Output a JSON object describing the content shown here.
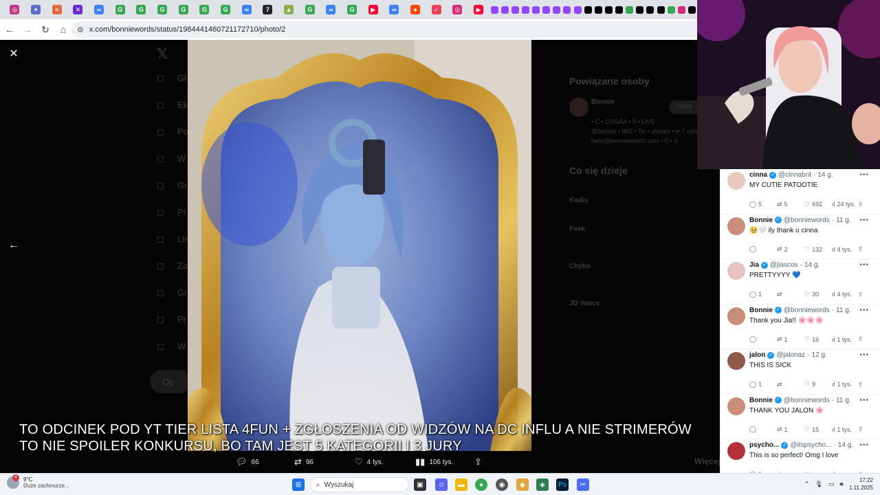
{
  "browser": {
    "url": "x.com/bonniewords/status/1984441460721172710/photo/2",
    "tabs": [
      {
        "icon": "instagram-favicon",
        "color": "#c13584",
        "glyph": "◎"
      },
      {
        "icon": "sparkle-favicon",
        "color": "#5b6cd1",
        "glyph": "✦"
      },
      {
        "icon": "stack-favicon",
        "color": "#e86a3a",
        "glyph": "≡"
      },
      {
        "icon": "x-close-favicon",
        "color": "#6a2bd3",
        "glyph": "✕"
      },
      {
        "icon": "copilot-favicon",
        "color": "#3b82f6",
        "glyph": "∞"
      },
      {
        "icon": "google-favicon",
        "color": "#34a853",
        "glyph": "G"
      },
      {
        "icon": "google-favicon",
        "color": "#34a853",
        "glyph": "G"
      },
      {
        "icon": "google-favicon",
        "color": "#34a853",
        "glyph": "G"
      },
      {
        "icon": "google-favicon",
        "color": "#34a853",
        "glyph": "G"
      },
      {
        "icon": "google-favicon",
        "color": "#34a853",
        "glyph": "G"
      },
      {
        "icon": "google-favicon",
        "color": "#34a853",
        "glyph": "G"
      },
      {
        "icon": "copilot-favicon",
        "color": "#3b82f6",
        "glyph": "∞"
      },
      {
        "icon": "seven-favicon",
        "color": "#222222",
        "glyph": "7"
      },
      {
        "icon": "drive-favicon",
        "color": "#8ab04a",
        "glyph": "▲"
      },
      {
        "icon": "google-favicon",
        "color": "#34a853",
        "glyph": "G"
      },
      {
        "icon": "copilot-favicon",
        "color": "#3b82f6",
        "glyph": "∞"
      },
      {
        "icon": "google-favicon",
        "color": "#34a853",
        "glyph": "G"
      },
      {
        "icon": "youtube-favicon",
        "color": "#ff0033",
        "glyph": "▶"
      },
      {
        "icon": "copilot-favicon",
        "color": "#3b82f6",
        "glyph": "∞"
      },
      {
        "icon": "reddit-favicon",
        "color": "#ff4500",
        "glyph": "●"
      },
      {
        "icon": "pocket-favicon",
        "color": "#ef3f56",
        "glyph": "✓"
      },
      {
        "icon": "instagram-favicon",
        "color": "#d62976",
        "glyph": "◎"
      },
      {
        "icon": "youtube-favicon",
        "color": "#ff0033",
        "glyph": "▶"
      }
    ],
    "small_tabs": [
      {
        "icon": "twitch-favicon",
        "color": "#9146ff"
      },
      {
        "icon": "twitch-favicon",
        "color": "#9146ff"
      },
      {
        "icon": "twitch-favicon",
        "color": "#9146ff"
      },
      {
        "icon": "twitch-favicon",
        "color": "#9146ff"
      },
      {
        "icon": "twitch-favicon",
        "color": "#9146ff"
      },
      {
        "icon": "twitch-favicon",
        "color": "#9146ff"
      },
      {
        "icon": "twitch-favicon",
        "color": "#9146ff"
      },
      {
        "icon": "twitch-favicon",
        "color": "#9146ff"
      },
      {
        "icon": "twitch-favicon",
        "color": "#9146ff"
      },
      {
        "icon": "x-favicon",
        "color": "#000000"
      },
      {
        "icon": "x-favicon",
        "color": "#000000"
      },
      {
        "icon": "x-favicon",
        "color": "#000000"
      },
      {
        "icon": "x-favicon",
        "color": "#000000"
      },
      {
        "icon": "google-favicon",
        "color": "#34a853"
      },
      {
        "icon": "x-favicon",
        "color": "#000000"
      },
      {
        "icon": "x-favicon",
        "color": "#000000"
      },
      {
        "icon": "x-favicon",
        "color": "#000000"
      },
      {
        "icon": "google-favicon",
        "color": "#34a853"
      },
      {
        "icon": "instagram-favicon",
        "color": "#d62976"
      },
      {
        "icon": "x-favicon",
        "color": "#000000"
      }
    ]
  },
  "background_page": {
    "sidebar_labels": [
      "Gł",
      "Ek",
      "Po",
      "W",
      "Gr",
      "Pr",
      "Lis",
      "Za",
      "Gr",
      "Pr",
      "W"
    ],
    "post_button": "Op",
    "related_title": "Powiązane osoby",
    "related_user": "Bonnie",
    "related_bio_lines": [
      "• C • CHGAA • 9 • LIVE",
      "@bonnie • BIO • Tw • stream • e-7 contact",
      "hello@bonniewords.com • 0 • ci"
    ],
    "follow_label": "Obse",
    "trending_title": "Co się dzieje",
    "trends": [
      "Kadis",
      "Peek",
      "Chybo",
      "JD Vance"
    ],
    "show_more": "Więcej"
  },
  "viewer": {
    "close_label": "Zamknij",
    "prev_label": "Poprzednie",
    "subtitle_lines": [
      "TO ODCINEK POD YT TIER LISTA 4FUN + ZGŁOSZENIA OD WIDZÓW NA DC INFLU A NIE STRIMERÓW",
      "TO NIE SPOILER KONKURSU, BO TAM JEST 5 KATEGORII I 3 JURY"
    ],
    "actions": {
      "replies": "66",
      "reposts": "96",
      "likes": "4 tys.",
      "views": "106 tys."
    }
  },
  "replies": [
    {
      "name": "cinna",
      "handle": "@cinnabrit",
      "time": "14 g.",
      "text": "MY CUTIE PATOOTIE",
      "replies": "5",
      "reposts": "5",
      "likes": "692",
      "views": "24 tys.",
      "avatar_color": "#e8c9c0"
    },
    {
      "name": "Bonnie",
      "handle": "@bonniewords",
      "time": "11 g.",
      "text": "🥹🤍 ily thank u cinna",
      "replies": "",
      "reposts": "2",
      "likes": "132",
      "views": "4 tys.",
      "avatar_color": "#c98d7a"
    },
    {
      "name": "Jia",
      "handle": "@jiascos",
      "time": "14 g.",
      "text": "PRETTYYYY 💙",
      "replies": "1",
      "reposts": "",
      "likes": "30",
      "views": "4 tys.",
      "avatar_color": "#e6c2c6"
    },
    {
      "name": "Bonnie",
      "handle": "@bonniewords",
      "time": "11 g.",
      "text": "Thank you Jia!! 🌸🌸🌸",
      "replies": "",
      "reposts": "1",
      "likes": "16",
      "views": "1 tys.",
      "avatar_color": "#c98d7a"
    },
    {
      "name": "jalon",
      "handle": "@jalonaz",
      "time": "12 g.",
      "text": "THIS IS SICK",
      "replies": "1",
      "reposts": "",
      "likes": "9",
      "views": "1 tys.",
      "avatar_color": "#8f5a4a"
    },
    {
      "name": "Bonnie",
      "handle": "@bonniewords",
      "time": "11 g.",
      "text": "THANK YOU JALON 🌸",
      "replies": "",
      "reposts": "1",
      "likes": "15",
      "views": "1 tys.",
      "avatar_color": "#c98d7a"
    },
    {
      "name": "psycho...",
      "handle": "@itspsycho...",
      "time": "14 g.",
      "text": "This is so perfect! Omg I love",
      "replies": "1",
      "reposts": "",
      "likes": "",
      "views": "",
      "avatar_color": "#b5303a"
    }
  ],
  "taskbar": {
    "weather_badge": "4",
    "temperature": "9°C",
    "condition": "Duże zachmurze...",
    "search_placeholder": "Wyszukaj",
    "time": "17:22",
    "date": "1.11.2025"
  }
}
